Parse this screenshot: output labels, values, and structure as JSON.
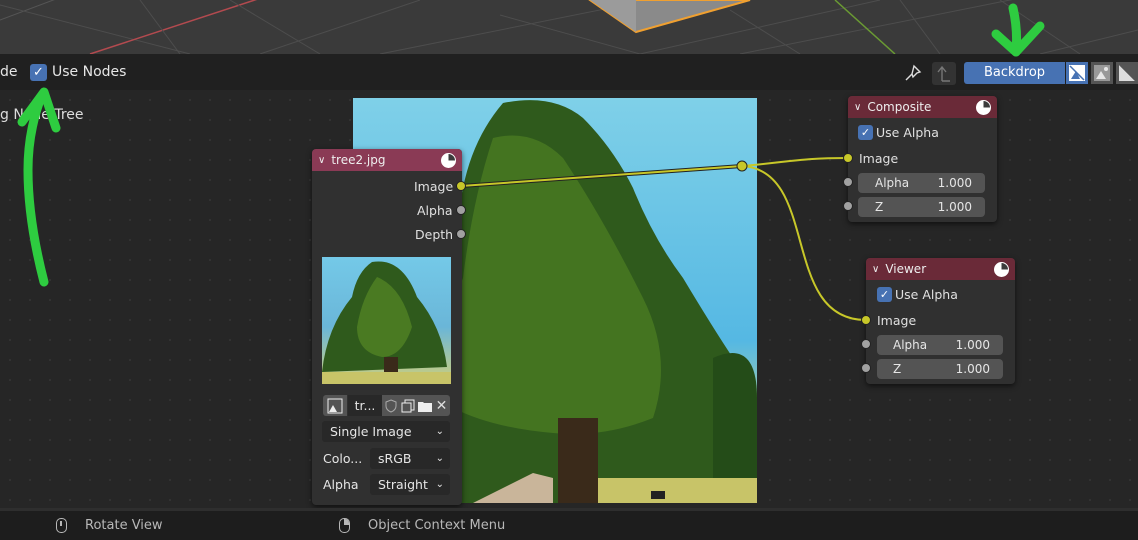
{
  "header": {
    "partial_label_left": "de",
    "use_nodes_label": "Use Nodes",
    "use_nodes_checked": true,
    "backdrop_label": "Backdrop",
    "backdrop_active": true,
    "icons": [
      "pin-icon",
      "parent-node-tree-icon",
      "backdrop-channels-icon",
      "backdrop-alpha-icon",
      "backdrop-color-icon"
    ]
  },
  "editor": {
    "partial_overlay_text": "g Node Tree"
  },
  "image_node": {
    "title": "tree2.jpg",
    "outputs": [
      "Image",
      "Alpha",
      "Depth"
    ],
    "image_name": "tr...",
    "source": "Single Image",
    "color_label": "Colo...",
    "color_space": "sRGB",
    "alpha_label": "Alpha",
    "alpha_mode": "Straight"
  },
  "composite_node": {
    "title": "Composite",
    "use_alpha_label": "Use Alpha",
    "use_alpha_checked": true,
    "input_image": "Image",
    "inputs": [
      {
        "label": "Alpha",
        "value": "1.000"
      },
      {
        "label": "Z",
        "value": "1.000"
      }
    ]
  },
  "viewer_node": {
    "title": "Viewer",
    "use_alpha_label": "Use Alpha",
    "use_alpha_checked": true,
    "input_image": "Image",
    "inputs": [
      {
        "label": "Alpha",
        "value": "1.000"
      },
      {
        "label": "Z",
        "value": "1.000"
      }
    ]
  },
  "statusbar": {
    "items": [
      {
        "icon": "mouse-middle-icon",
        "label": "Rotate View"
      },
      {
        "icon": "mouse-right-icon",
        "label": "Object Context Menu"
      }
    ]
  },
  "colors": {
    "accent": "#4772b3",
    "image_node_header": "#8a3a55",
    "output_node_header": "#6a2a38",
    "link": "#c7c729",
    "annotation_arrow": "#2ecc40"
  }
}
